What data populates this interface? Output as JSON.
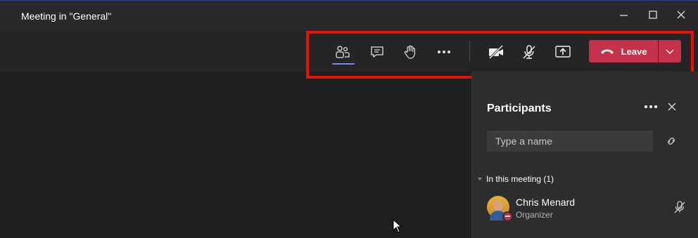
{
  "window": {
    "title": "Meeting in \"General\""
  },
  "toolbar": {
    "buttons": [
      {
        "icon": "participants-icon",
        "active": true
      },
      {
        "icon": "chat-icon"
      },
      {
        "icon": "raise-hand-icon"
      },
      {
        "icon": "more-options-icon"
      },
      {
        "icon": "camera-off-icon"
      },
      {
        "icon": "mic-off-icon"
      },
      {
        "icon": "share-screen-icon"
      }
    ],
    "leave_label": "Leave"
  },
  "participants_panel": {
    "title": "Participants",
    "search_placeholder": "Type a name",
    "section_label": "In this meeting (1)",
    "people": [
      {
        "name": "Chris Menard",
        "role": "Organizer",
        "status": "busy",
        "muted": true
      }
    ]
  },
  "colors": {
    "leave": "#c4314b",
    "highlight": "#e8110a",
    "accent": "#7f85f5"
  }
}
